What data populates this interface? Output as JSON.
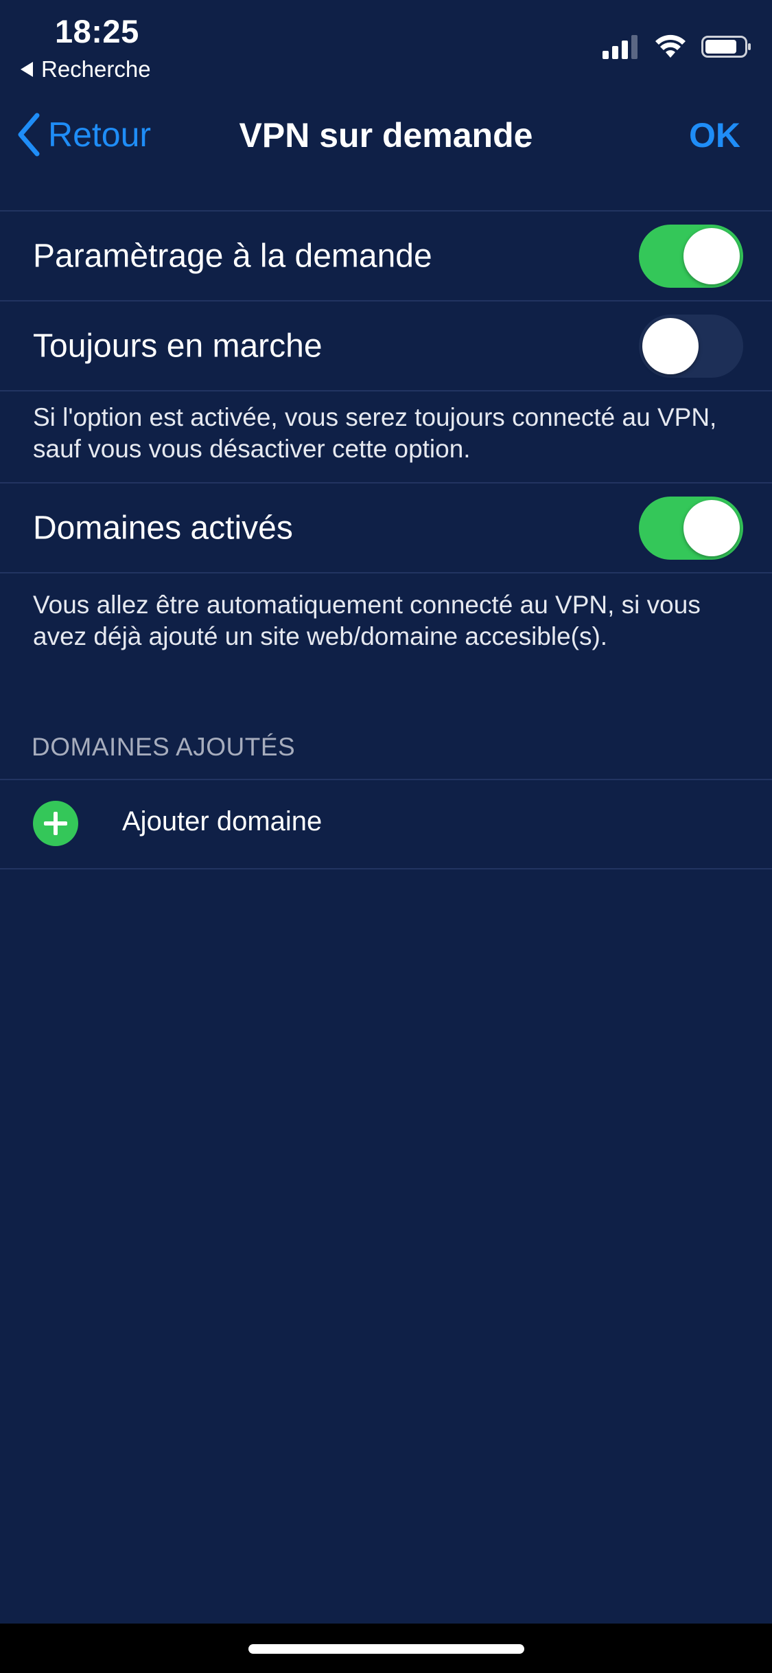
{
  "status_bar": {
    "time": "18:25",
    "back_app": "Recherche"
  },
  "nav": {
    "back_label": "Retour",
    "title": "VPN sur demande",
    "ok_label": "OK"
  },
  "settings": {
    "on_demand": {
      "label": "Paramètrage à la demande",
      "enabled": true
    },
    "always_on": {
      "label": "Toujours en marche",
      "enabled": false
    },
    "always_on_note": "Si l'option est activée, vous serez toujours connecté au VPN, sauf vous vous désactiver cette option.",
    "domains_enabled": {
      "label": "Domaines activés",
      "enabled": true
    },
    "domains_note": "Vous allez être automatiquement connecté au VPN, si vous avez déjà ajouté un site web/domaine accesible(s)."
  },
  "added_domains": {
    "header": "DOMAINES AJOUTÉS",
    "add_label": "Ajouter domaine"
  },
  "colors": {
    "background": "#0f2047",
    "accent_blue": "#1f8df7",
    "toggle_on": "#34c759",
    "toggle_off": "#1d2f57",
    "separator": "#223461"
  }
}
